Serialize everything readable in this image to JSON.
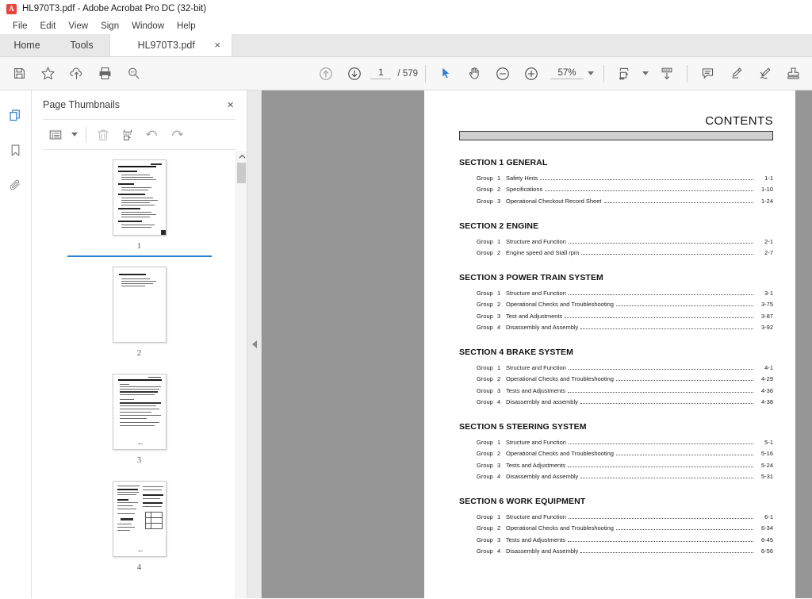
{
  "window": {
    "title": "HL970T3.pdf - Adobe Acrobat Pro DC (32-bit)",
    "app_icon": "A",
    "accent_color": "#2f7fd1",
    "brand_color": "#e8453c"
  },
  "menubar": {
    "items": [
      {
        "label": "File"
      },
      {
        "label": "Edit"
      },
      {
        "label": "View"
      },
      {
        "label": "Sign"
      },
      {
        "label": "Window"
      },
      {
        "label": "Help"
      }
    ]
  },
  "tabs": {
    "home": "Home",
    "tools": "Tools",
    "document": "HL970T3.pdf",
    "close_glyph": "×"
  },
  "toolbar": {
    "save_label": "save-file",
    "star_label": "add-to-favorites",
    "upload_label": "upload-to-cloud",
    "print_label": "print-file",
    "search_label": "find-text",
    "prev_page_label": "previous-page",
    "next_page_label": "next-page",
    "page_current": "1",
    "page_separator": "/",
    "page_total": "579",
    "select_label": "select-tool",
    "hand_label": "hand-tool",
    "zoom_out_label": "zoom-out",
    "zoom_in_label": "zoom-in",
    "zoom_value": "57%",
    "fit_label": "fit-page-width",
    "scroll_label": "scrolling-mode",
    "comment_label": "add-comment",
    "highlight_label": "highlight-text",
    "sign_label": "fill-and-sign",
    "stamp_label": "add-stamp"
  },
  "rail": {
    "items": [
      {
        "name": "page-thumbnails",
        "label": "Page Thumbnails",
        "active": true
      },
      {
        "name": "bookmarks",
        "label": "Bookmarks",
        "active": false
      },
      {
        "name": "attachments",
        "label": "Attachments",
        "active": false
      }
    ]
  },
  "thumbnail_panel": {
    "title": "Page Thumbnails",
    "close_glyph": "×",
    "toolbar": {
      "options_label": "thumbnail-options",
      "delete_label": "delete-pages",
      "extract_label": "extract-pages",
      "rotate_ccw_label": "rotate-counterclockwise",
      "rotate_cw_label": "rotate-clockwise"
    },
    "thumbnails": [
      {
        "number": "1",
        "selected": true
      },
      {
        "number": "2",
        "selected": false
      },
      {
        "number": "3",
        "selected": false
      },
      {
        "number": "4",
        "selected": false
      }
    ]
  },
  "document": {
    "page_title": "CONTENTS",
    "sections": [
      {
        "heading": "SECTION 1  GENERAL",
        "entries": [
          {
            "group": "Group",
            "num": "1",
            "title": "Safety Hints",
            "page": "1-1"
          },
          {
            "group": "Group",
            "num": "2",
            "title": "Specifications",
            "page": "1-10"
          },
          {
            "group": "Group",
            "num": "3",
            "title": "Operational Checkout Record Sheet",
            "page": "1-24"
          }
        ]
      },
      {
        "heading": "SECTION 2  ENGINE",
        "entries": [
          {
            "group": "Group",
            "num": "1",
            "title": "Structure and Function",
            "page": "2-1"
          },
          {
            "group": "Group",
            "num": "2",
            "title": "Engine speed and Stall rpm",
            "page": "2-7"
          }
        ]
      },
      {
        "heading": "SECTION 3  POWER TRAIN SYSTEM",
        "entries": [
          {
            "group": "Group",
            "num": "1",
            "title": "Structure and Function",
            "page": "3-1"
          },
          {
            "group": "Group",
            "num": "2",
            "title": "Operational Checks and Troubleshooting",
            "page": "3-75"
          },
          {
            "group": "Group",
            "num": "3",
            "title": "Test and Adjustments",
            "page": "3-87"
          },
          {
            "group": "Group",
            "num": "4",
            "title": "Disassembly and Assembly",
            "page": "3-92"
          }
        ]
      },
      {
        "heading": "SECTION 4  BRAKE SYSTEM",
        "entries": [
          {
            "group": "Group",
            "num": "1",
            "title": "Structure and Function",
            "page": "4-1"
          },
          {
            "group": "Group",
            "num": "2",
            "title": "Operational Checks and Troubleshooting",
            "page": "4-29"
          },
          {
            "group": "Group",
            "num": "3",
            "title": "Tests and Adjustments",
            "page": "4-36"
          },
          {
            "group": "Group",
            "num": "4",
            "title": "Disassembly and assembly",
            "page": "4-38"
          }
        ]
      },
      {
        "heading": "SECTION 5  STEERING SYSTEM",
        "entries": [
          {
            "group": "Group",
            "num": "1",
            "title": "Structure and Function",
            "page": "5-1"
          },
          {
            "group": "Group",
            "num": "2",
            "title": "Operational Checks and Troubleshooting",
            "page": "5-16"
          },
          {
            "group": "Group",
            "num": "3",
            "title": "Tests and Adjustments",
            "page": "5-24"
          },
          {
            "group": "Group",
            "num": "4",
            "title": "Disassembly and Assembly",
            "page": "5-31"
          }
        ]
      },
      {
        "heading": "SECTION 6  WORK EQUIPMENT",
        "entries": [
          {
            "group": "Group",
            "num": "1",
            "title": "Structure and Function",
            "page": "6-1"
          },
          {
            "group": "Group",
            "num": "2",
            "title": "Operational Checks and Troubleshooting",
            "page": "6-34"
          },
          {
            "group": "Group",
            "num": "3",
            "title": "Tests and Adjustments",
            "page": "6-45"
          },
          {
            "group": "Group",
            "num": "4",
            "title": "Disassembly and Assembly",
            "page": "6-56"
          }
        ]
      }
    ]
  }
}
